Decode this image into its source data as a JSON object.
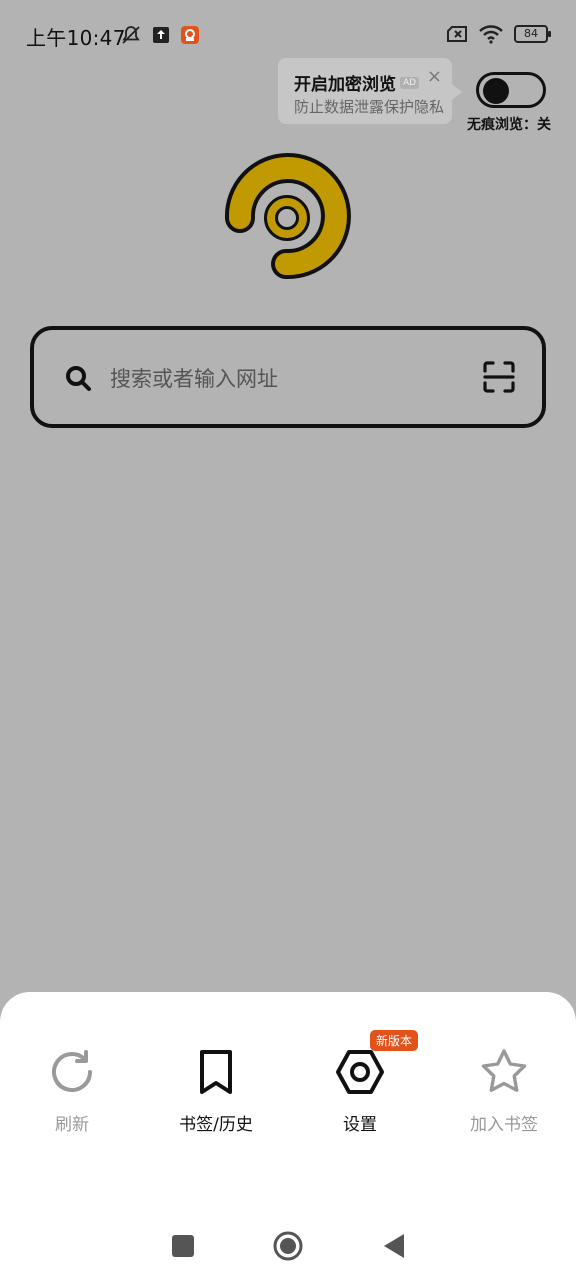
{
  "status_bar": {
    "time": "上午10:47",
    "battery": "84"
  },
  "icons": {
    "left": [
      "mute-bell-icon",
      "upload-icon",
      "app-icon"
    ],
    "right": [
      "sim-x-icon",
      "wifi-icon",
      "battery-icon"
    ]
  },
  "tooltip": {
    "title": "开启加密浏览",
    "ad": "AD",
    "subtitle": "防止数据泄露保护隐私",
    "close": "×"
  },
  "incognito": {
    "label": "无痕浏览：关",
    "on": false
  },
  "search": {
    "placeholder": "搜索或者输入网址"
  },
  "toolbar": {
    "refresh": "刷新",
    "bookmarks_history": "书签/历史",
    "settings": "设置",
    "settings_badge": "新版本",
    "add_bookmark": "加入书签"
  },
  "colors": {
    "background": "#b3b3b3",
    "logo": "#c09a00",
    "badge": "#e2531c"
  }
}
